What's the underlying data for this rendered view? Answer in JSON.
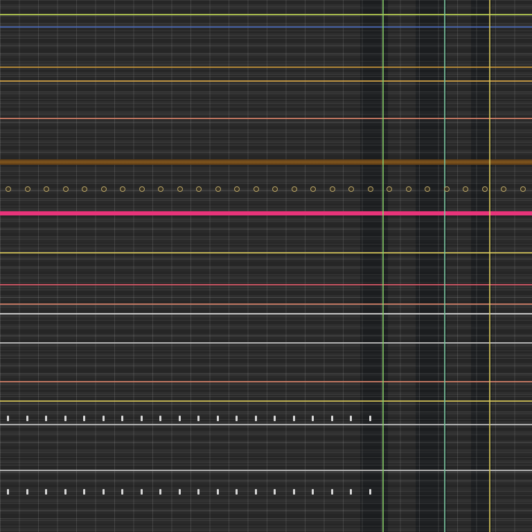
{
  "pattern": {
    "background": "#2b2b2b",
    "accent_colors": {
      "pink": "#e8347a",
      "yellow": "#d8c85a",
      "orange": "#c8963a",
      "salmon": "#d8826a",
      "green": "#8ad06a",
      "teal": "#4ab8a8",
      "blue": "#4a6ab8",
      "white": "#e0e0e0"
    }
  },
  "horizontal_lines": [
    {
      "name": "yellow-green-line-top",
      "color": "#b8d050"
    },
    {
      "name": "blue-line-top",
      "color": "#4a6ab8"
    },
    {
      "name": "orange-line-1",
      "color": "#c8963a"
    },
    {
      "name": "orange-line-2",
      "color": "#d8a84a"
    },
    {
      "name": "salmon-line-1",
      "color": "#d8826a"
    },
    {
      "name": "brown-band",
      "color": "#8a5a1c"
    },
    {
      "name": "pink-band",
      "color": "#e8347a"
    },
    {
      "name": "yellow-line-1",
      "color": "#d8c85a"
    },
    {
      "name": "red-line-1",
      "color": "#e05a6a"
    },
    {
      "name": "salmon-line-2",
      "color": "#d8826a"
    },
    {
      "name": "white-line-1",
      "color": "#e0e0e0"
    },
    {
      "name": "white-line-2",
      "color": "#c8c8c8"
    },
    {
      "name": "salmon-line-3",
      "color": "#d8826a"
    },
    {
      "name": "yellow-line-2",
      "color": "#d8c85a"
    },
    {
      "name": "white-line-3",
      "color": "#c8c8c8"
    },
    {
      "name": "white-line-4",
      "color": "#c8c8c8"
    }
  ],
  "vertical_lines": [
    {
      "name": "green-vertical-line",
      "color": "#8ad06a"
    },
    {
      "name": "teal-vertical-line",
      "color": "#7ac8a0"
    },
    {
      "name": "yellow-vertical-line",
      "color": "#d8c85a"
    }
  ]
}
